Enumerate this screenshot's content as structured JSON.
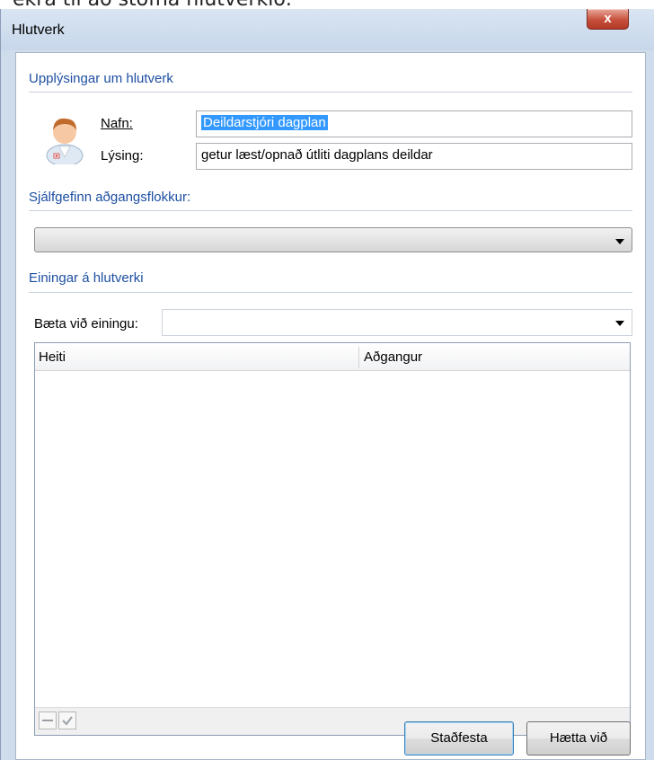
{
  "background_text": "ekra til að stofna hlutverkið.",
  "window": {
    "title": "Hlutverk",
    "close_glyph": "x"
  },
  "info_section": {
    "heading": "Upplýsingar um hlutverk",
    "name_label": "Nafn:",
    "name_value": "Deildarstjóri dagplan",
    "description_label": "Lýsing:",
    "description_value": "getur læst/opnað útliti dagplans deildar"
  },
  "access_section": {
    "heading": "Sjálfgefinn aðgangsflokkur:",
    "selected_value": ""
  },
  "units_section": {
    "heading": "Einingar á hlutverki",
    "add_unit_label": "Bæta við einingu:",
    "add_unit_value": ""
  },
  "grid": {
    "columns": [
      "Heiti",
      "Aðgangur"
    ],
    "rows": [],
    "toolbar": {
      "remove_icon": "minus-icon",
      "confirm_icon": "check-icon"
    }
  },
  "buttons": {
    "confirm": "Staðfesta",
    "cancel": "Hætta við"
  },
  "colors": {
    "section_heading": "#1e4fa3",
    "selection": "#3399ff",
    "close_button": "#c7503c"
  }
}
